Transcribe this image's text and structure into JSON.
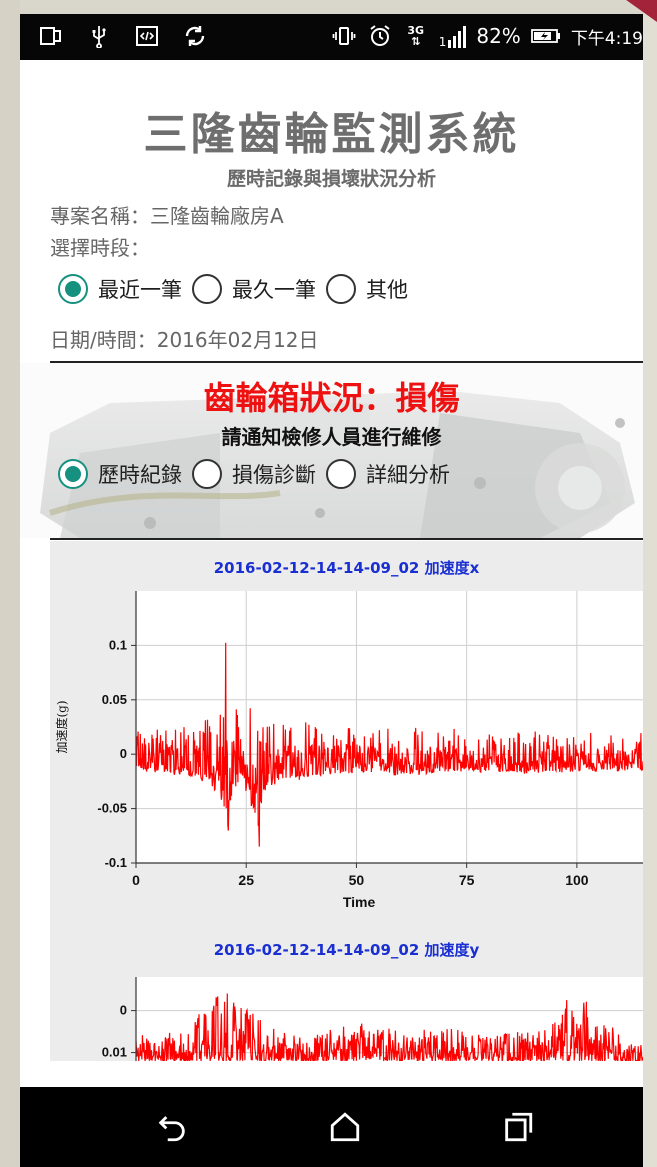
{
  "statusbar": {
    "battery_percent": "82%",
    "time": "下午4:19",
    "network_type": "3G",
    "sim_label": "1",
    "icons_left": [
      "device-icon",
      "usb-icon",
      "code-icon",
      "sync-icon"
    ],
    "icons_right": [
      "vibrate-icon",
      "alarm-icon",
      "network-3g-icon",
      "signal-icon",
      "battery-charging-icon"
    ]
  },
  "app": {
    "title": "三隆齒輪監測系統",
    "subtitle": "歷時記錄與損壞狀況分析",
    "project": "專案名稱：三隆齒輪廠房A",
    "period_label": "選擇時段：",
    "period_options": [
      {
        "label": "最近一筆",
        "checked": true
      },
      {
        "label": "最久一筆",
        "checked": false
      },
      {
        "label": "其他",
        "checked": false
      }
    ],
    "date": "日期/時間：2016年02月12日",
    "gear_status": "齒輪箱狀況：損傷",
    "repair_note": "請通知檢修人員進行維修",
    "view_options": [
      {
        "label": "歷時紀錄",
        "checked": true
      },
      {
        "label": "損傷診斷",
        "checked": false
      },
      {
        "label": "詳細分析",
        "checked": false
      }
    ]
  },
  "colors": {
    "accent": "#16907f",
    "alert": "#ee1111",
    "chart_line": "#ff0000",
    "chart_title": "#1a2fd1"
  },
  "chart_data": [
    {
      "type": "line",
      "title": "2016-02-12-14-14-09_02 加速度x",
      "xlabel": "Time",
      "ylabel": "加速度(g)",
      "xlim": [
        0,
        115
      ],
      "ylim": [
        -0.1,
        0.15
      ],
      "xticks": [
        0,
        25,
        50,
        75,
        100
      ],
      "yticks": [
        -0.1,
        -0.05,
        0,
        0.05,
        0.1
      ],
      "ytick_labels": [
        "-0.1",
        "-0.05",
        "0",
        "0.05",
        "0.1"
      ],
      "grid": true,
      "series": [
        {
          "color": "#ff0000",
          "x": [
            0,
            5,
            10,
            15,
            17,
            18,
            19,
            20,
            20.5,
            21,
            21.5,
            22,
            23,
            24,
            25,
            26,
            27,
            27.5,
            28,
            28.5,
            29,
            29.5,
            30,
            31,
            32,
            33,
            35,
            40,
            45,
            50,
            55,
            60,
            70,
            80,
            90,
            100,
            110,
            115
          ],
          "y_max": [
            0.025,
            0.028,
            0.026,
            0.03,
            0.035,
            0.045,
            0.04,
            0.05,
            0.135,
            0.035,
            0.03,
            0.048,
            0.04,
            0.035,
            0.05,
            0.045,
            0.055,
            0.06,
            0.05,
            0.045,
            0.04,
            0.048,
            0.035,
            0.04,
            0.038,
            0.035,
            0.03,
            0.03,
            0.028,
            0.028,
            0.025,
            0.025,
            0.024,
            0.022,
            0.022,
            0.02,
            0.02,
            0.02
          ],
          "y_min": [
            -0.015,
            -0.018,
            -0.02,
            -0.025,
            -0.03,
            -0.04,
            -0.035,
            -0.055,
            -0.06,
            -0.09,
            -0.045,
            -0.04,
            -0.03,
            -0.025,
            -0.04,
            -0.05,
            -0.06,
            -0.055,
            -0.095,
            -0.045,
            -0.035,
            -0.04,
            -0.03,
            -0.03,
            -0.028,
            -0.025,
            -0.025,
            -0.022,
            -0.02,
            -0.02,
            -0.018,
            -0.02,
            -0.018,
            -0.018,
            -0.018,
            -0.017,
            -0.016,
            -0.016
          ]
        }
      ]
    },
    {
      "type": "line",
      "title": "2016-02-12-14-14-09_02 加速度y",
      "xlabel": "",
      "ylabel": "",
      "xlim": [
        0,
        115
      ],
      "ylim": [
        -0.012,
        0.008
      ],
      "yticks": [
        0,
        -0.01
      ],
      "ytick_labels": [
        "0",
        "0.01"
      ],
      "grid": true,
      "series": [
        {
          "color": "#ff0000",
          "x": [
            0,
            10,
            20,
            30,
            40,
            50,
            60,
            70,
            80,
            90,
            100,
            110,
            115
          ],
          "y_max": [
            -0.006,
            -0.005,
            0.006,
            -0.004,
            -0.006,
            -0.002,
            -0.005,
            -0.004,
            -0.006,
            -0.004,
            0.005,
            -0.006,
            -0.008
          ],
          "y_min": [
            -0.012,
            -0.012,
            -0.012,
            -0.012,
            -0.012,
            -0.012,
            -0.012,
            -0.012,
            -0.012,
            -0.012,
            -0.012,
            -0.012,
            -0.012
          ]
        }
      ]
    }
  ]
}
